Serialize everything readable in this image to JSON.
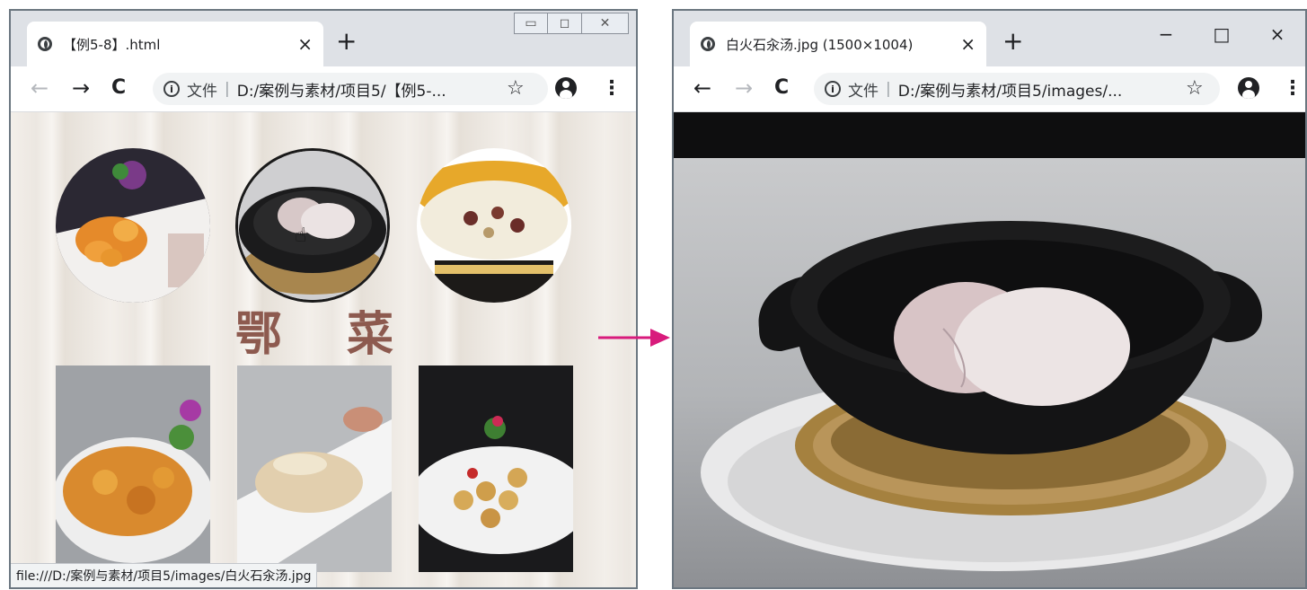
{
  "left_window": {
    "tab_title": "【例5-8】.html",
    "omnibox_label": "文件",
    "omnibox_url": "D:/案例与素材/项目5/【例5-...",
    "page": {
      "title_chars": [
        "鄂",
        "菜"
      ]
    },
    "status_bar": "file:///D:/案例与素材/项目5/images/白火石汆汤.jpg"
  },
  "right_window": {
    "tab_title": "白火石汆汤.jpg (1500×1004)",
    "omnibox_label": "文件",
    "omnibox_url": "D:/案例与素材/项目5/images/..."
  },
  "icons": {
    "back": "←",
    "forward": "→",
    "reload": "C",
    "info": "i",
    "star": "☆",
    "menu": "⋮",
    "close_tab": "×",
    "new_tab": "+",
    "minimize": "−",
    "maximize": "□",
    "close": "×"
  },
  "colors": {
    "arrow": "#d81b7c",
    "title_text": "#8d5a4f"
  }
}
